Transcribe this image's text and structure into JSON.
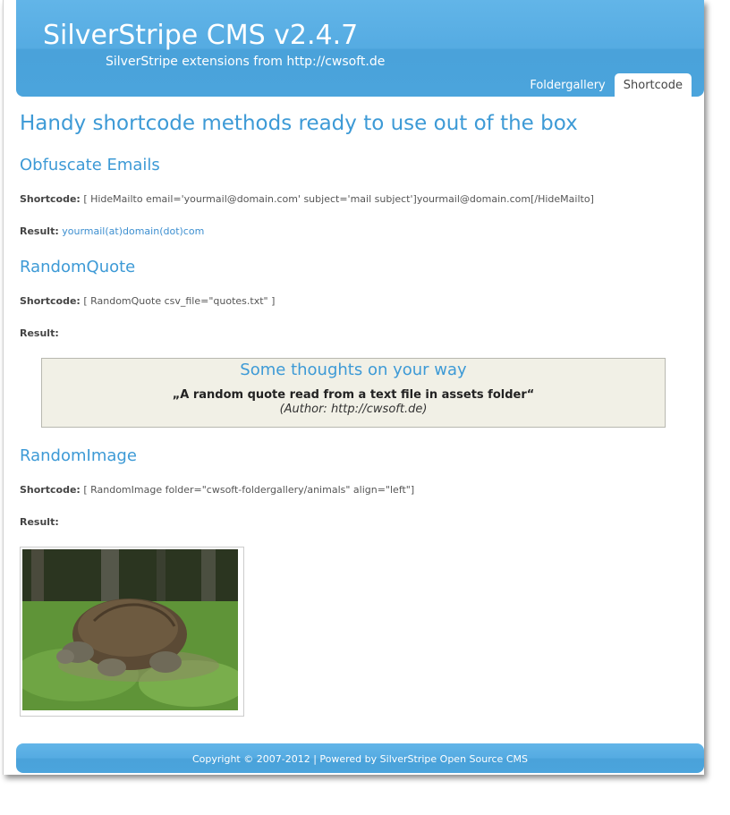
{
  "header": {
    "title": "SilverStripe CMS v2.4.7",
    "subtitle": "SilverStripe extensions from http://cwsoft.de"
  },
  "nav": {
    "tabs": [
      {
        "label": "Foldergallery",
        "active": false
      },
      {
        "label": "Shortcode",
        "active": true
      }
    ]
  },
  "main": {
    "heading": "Handy shortcode methods ready to use out of the box",
    "shortcode_label": "Shortcode:",
    "result_label": "Result:",
    "sections": [
      {
        "heading": "Obfuscate Emails",
        "shortcode": "[ HideMailto email='yourmail@domain.com' subject='mail subject']yourmail@domain.com[/HideMailto]",
        "result": "yourmail(at)domain(dot)com"
      },
      {
        "heading": "RandomQuote",
        "shortcode": "[ RandomQuote csv_file=\"quotes.txt\" ]",
        "result": ""
      },
      {
        "heading": "RandomImage",
        "shortcode": "[ RandomImage folder=\"cwsoft-foldergallery/animals\" align=\"left\"]",
        "result": ""
      }
    ],
    "quote_box": {
      "title": "Some thoughts on your way",
      "quote": "„A random quote read from a text file in assets folder“",
      "author": "(Author: http://cwsoft.de)"
    },
    "image": {
      "subject": "giant tortoise on grass"
    }
  },
  "footer": {
    "text": "Copyright © 2007-2012 | Powered by SilverStripe Open Source CMS"
  },
  "colors": {
    "brand_blue": "#4ba4dc",
    "heading_blue": "#3d9ad6",
    "link_blue": "#3d8fd0",
    "quote_bg": "#f1f0e6"
  }
}
